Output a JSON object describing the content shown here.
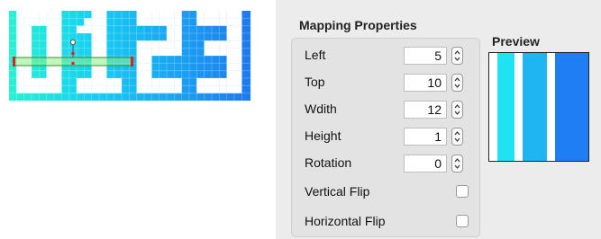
{
  "display": {
    "digits": "0123"
  },
  "mapping": {
    "title": "Mapping Properties",
    "fields": [
      {
        "label": "Left",
        "value": "5"
      },
      {
        "label": "Top",
        "value": "10"
      },
      {
        "label": "Wdith",
        "value": "12"
      },
      {
        "label": "Height",
        "value": "1"
      },
      {
        "label": "Rotation",
        "value": "0"
      }
    ],
    "checkboxes": [
      {
        "label": "Vertical Flip",
        "checked": false
      },
      {
        "label": "Horizontal Flip",
        "checked": false
      }
    ]
  },
  "preview": {
    "title": "Preview",
    "stripe_colors": [
      "#ffffff",
      "#1fe3f2",
      "#1fe3f2",
      "#ffffff",
      "#1fb5f3",
      "#1fb5f3",
      "#1fb5f3",
      "#ffffff",
      "#1f7ef3",
      "#1f7ef3",
      "#1f7ef3",
      "#1f7ef3"
    ]
  }
}
